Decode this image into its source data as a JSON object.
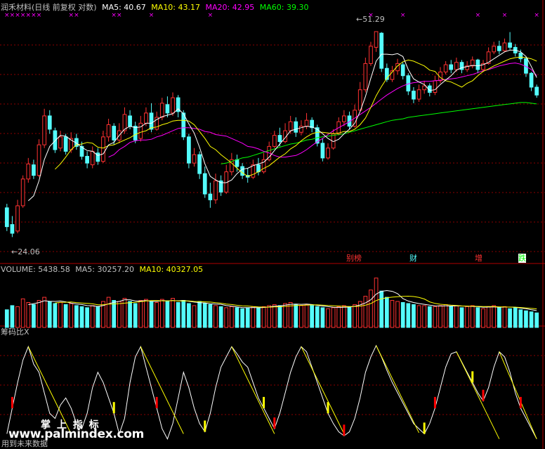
{
  "title": "润禾材料(日线 前复权 对数)",
  "colors": {
    "up": "#ff3232",
    "down": "#54fcfc",
    "ma5": "#ffffff",
    "ma10": "#ffff00",
    "ma20": "#ff00ff",
    "ma60": "#00ff00",
    "grid": "#8b0000",
    "text": "#c0c0c0"
  },
  "price_header": [
    {
      "text": "MA5: 40.67",
      "color": "#ffffff"
    },
    {
      "text": "MA10: 43.17",
      "color": "#ffff00"
    },
    {
      "text": "MA20: 42.95",
      "color": "#ff00ff"
    },
    {
      "text": "MA60: 39.30",
      "color": "#00ff00"
    }
  ],
  "volume_header": [
    {
      "text": "VOLUME: 5438.58",
      "color": "#c0c0c0"
    },
    {
      "text": "MA5: 30257.20",
      "color": "#c0c0c0"
    },
    {
      "text": "MA10: 40327.05",
      "color": "#ffff00"
    }
  ],
  "indicator_title": "筹码比X",
  "high_label": "51.29",
  "low_label": "24.06",
  "events": [
    {
      "text": "别榜",
      "color": "#ff3232"
    },
    {
      "text": "财",
      "color": "#54fcfc"
    },
    {
      "text": "增",
      "color": "#ff3232"
    },
    {
      "text": "跌",
      "color": "#00ff00"
    }
  ],
  "watermark": {
    "title": "掌 上 指 标",
    "subtitle": "用到未来数据",
    "site": "www.palmindex.com"
  },
  "chart_data": {
    "type": "candlestick",
    "title": "润禾材料(日线 前复权 对数)",
    "scale": "log",
    "ylim": [
      22,
      55
    ],
    "high_marker": 51.29,
    "low_marker": 24.06,
    "candles": [
      [
        26.8,
        25.0,
        27.2,
        24.6
      ],
      [
        25.2,
        24.4,
        26.0,
        24.06
      ],
      [
        24.6,
        27.0,
        27.6,
        24.4
      ],
      [
        27.0,
        29.8,
        30.2,
        26.8
      ],
      [
        29.8,
        31.5,
        32.2,
        29.4
      ],
      [
        31.4,
        30.2,
        32.0,
        29.8
      ],
      [
        30.2,
        33.8,
        34.5,
        30.0
      ],
      [
        33.8,
        37.6,
        38.6,
        33.4
      ],
      [
        37.6,
        35.8,
        38.4,
        35.2
      ],
      [
        35.6,
        33.2,
        36.0,
        32.8
      ],
      [
        33.4,
        34.8,
        35.6,
        33.0
      ],
      [
        34.8,
        33.0,
        35.2,
        32.6
      ],
      [
        33.2,
        34.6,
        35.4,
        32.8
      ],
      [
        34.6,
        33.6,
        35.2,
        33.2
      ],
      [
        33.6,
        32.4,
        34.2,
        32.0
      ],
      [
        32.4,
        31.6,
        33.0,
        31.0
      ],
      [
        31.4,
        33.0,
        33.6,
        31.0
      ],
      [
        32.8,
        31.8,
        33.4,
        31.4
      ],
      [
        31.8,
        34.8,
        35.6,
        31.6
      ],
      [
        34.8,
        36.4,
        37.2,
        34.2
      ],
      [
        36.2,
        34.4,
        36.6,
        33.8
      ],
      [
        34.4,
        35.6,
        36.6,
        34.0
      ],
      [
        35.6,
        37.8,
        38.8,
        35.2
      ],
      [
        37.6,
        36.2,
        38.4,
        35.8
      ],
      [
        36.2,
        34.4,
        36.8,
        34.0
      ],
      [
        34.6,
        36.6,
        37.6,
        34.2
      ],
      [
        36.6,
        38.0,
        38.8,
        36.2
      ],
      [
        38.0,
        35.8,
        39.4,
        35.4
      ],
      [
        35.8,
        37.4,
        38.2,
        35.6
      ],
      [
        37.4,
        39.4,
        40.2,
        37.0
      ],
      [
        39.2,
        38.0,
        40.4,
        37.4
      ],
      [
        38.0,
        40.2,
        41.0,
        37.6
      ],
      [
        40.2,
        38.2,
        40.6,
        37.4
      ],
      [
        38.0,
        34.8,
        38.4,
        34.4
      ],
      [
        34.8,
        31.6,
        35.2,
        31.0
      ],
      [
        31.6,
        32.6,
        33.4,
        31.2
      ],
      [
        32.6,
        30.4,
        33.0,
        29.8
      ],
      [
        30.4,
        28.2,
        31.2,
        27.8
      ],
      [
        28.2,
        27.6,
        29.4,
        26.8
      ],
      [
        27.6,
        29.6,
        30.4,
        27.2
      ],
      [
        29.6,
        28.4,
        30.2,
        28.0
      ],
      [
        28.4,
        30.6,
        31.4,
        28.2
      ],
      [
        30.6,
        32.0,
        32.8,
        30.2
      ],
      [
        32.0,
        31.2,
        32.6,
        30.6
      ],
      [
        31.2,
        30.2,
        31.6,
        29.8
      ],
      [
        30.2,
        30.0,
        31.0,
        29.4
      ],
      [
        30.0,
        31.4,
        32.0,
        29.8
      ],
      [
        31.4,
        30.6,
        32.2,
        30.2
      ],
      [
        30.6,
        32.0,
        32.8,
        30.4
      ],
      [
        32.0,
        33.6,
        34.2,
        31.8
      ],
      [
        33.6,
        35.0,
        35.6,
        33.4
      ],
      [
        35.0,
        34.2,
        36.0,
        33.6
      ],
      [
        34.2,
        35.6,
        36.6,
        34.0
      ],
      [
        35.6,
        36.8,
        37.6,
        35.2
      ],
      [
        36.8,
        35.4,
        37.4,
        34.8
      ],
      [
        35.4,
        36.2,
        37.0,
        35.0
      ],
      [
        36.2,
        37.0,
        38.0,
        35.8
      ],
      [
        37.0,
        36.0,
        37.4,
        35.4
      ],
      [
        36.0,
        34.0,
        36.4,
        33.6
      ],
      [
        34.0,
        32.2,
        34.6,
        31.8
      ],
      [
        32.2,
        33.4,
        34.0,
        32.0
      ],
      [
        33.4,
        35.2,
        35.8,
        33.2
      ],
      [
        35.2,
        36.8,
        37.4,
        35.0
      ],
      [
        36.8,
        37.6,
        38.4,
        36.2
      ],
      [
        37.6,
        36.2,
        38.2,
        35.8
      ],
      [
        36.2,
        38.4,
        39.2,
        36.0
      ],
      [
        38.4,
        41.4,
        42.6,
        38.2
      ],
      [
        41.4,
        45.6,
        46.6,
        41.0
      ],
      [
        45.6,
        48.6,
        49.4,
        45.2
      ],
      [
        48.4,
        51.29,
        51.29,
        47.6
      ],
      [
        51.0,
        44.8,
        51.2,
        44.2
      ],
      [
        44.8,
        43.0,
        45.6,
        42.6
      ],
      [
        43.0,
        44.4,
        45.2,
        42.6
      ],
      [
        44.4,
        45.6,
        46.4,
        43.8
      ],
      [
        45.4,
        43.6,
        45.8,
        43.0
      ],
      [
        43.6,
        41.2,
        44.0,
        40.6
      ],
      [
        41.2,
        40.0,
        41.8,
        39.4
      ],
      [
        40.0,
        41.4,
        42.2,
        39.6
      ],
      [
        41.4,
        42.0,
        42.8,
        40.8
      ],
      [
        42.0,
        41.0,
        42.4,
        40.4
      ],
      [
        41.0,
        42.8,
        43.6,
        40.6
      ],
      [
        42.8,
        44.2,
        45.0,
        42.4
      ],
      [
        44.2,
        45.4,
        46.0,
        43.8
      ],
      [
        45.4,
        44.6,
        46.2,
        44.0
      ],
      [
        44.6,
        45.8,
        46.6,
        44.2
      ],
      [
        45.8,
        44.6,
        46.2,
        44.0
      ],
      [
        44.6,
        45.2,
        46.0,
        44.2
      ],
      [
        45.2,
        46.2,
        46.8,
        44.8
      ],
      [
        46.2,
        44.6,
        46.4,
        44.0
      ],
      [
        44.6,
        45.6,
        46.2,
        44.2
      ],
      [
        45.6,
        47.6,
        48.4,
        45.4
      ],
      [
        47.6,
        48.6,
        49.4,
        47.2
      ],
      [
        48.6,
        47.8,
        49.6,
        47.2
      ],
      [
        47.8,
        49.2,
        50.0,
        47.6
      ],
      [
        49.2,
        48.4,
        51.2,
        48.0
      ],
      [
        48.4,
        47.4,
        49.0,
        46.8
      ],
      [
        47.4,
        46.4,
        48.0,
        45.8
      ],
      [
        46.4,
        44.0,
        46.8,
        43.4
      ],
      [
        44.0,
        41.8,
        44.2,
        41.2
      ],
      [
        41.8,
        40.6,
        42.2,
        40.2
      ]
    ],
    "ma5": [
      null,
      null,
      null,
      null,
      27.5,
      28.0,
      29.6,
      32.0,
      33.6,
      34.3,
      35.0,
      34.9,
      34.4,
      34.0,
      33.5,
      33.1,
      33.0,
      32.5,
      32.7,
      33.8,
      34.1,
      35.0,
      35.8,
      36.2,
      36.0,
      36.1,
      36.6,
      36.6,
      37.1,
      37.5,
      37.7,
      37.9,
      38.6,
      37.9,
      36.5,
      35.3,
      33.5,
      31.5,
      30.1,
      29.7,
      29.4,
      29.4,
      29.7,
      30.4,
      30.9,
      31.0,
      31.3,
      31.5,
      31.7,
      32.3,
      33.1,
      33.9,
      34.7,
      35.6,
      35.8,
      36.0,
      36.2,
      36.1,
      35.8,
      35.2,
      34.6,
      34.2,
      34.5,
      35.2,
      35.8,
      36.6,
      38.2,
      40.4,
      43.2,
      46.0,
      47.2,
      47.2,
      47.1,
      47.3,
      46.8,
      44.6,
      43.1,
      42.6,
      42.2,
      41.3,
      41.4,
      42.2,
      42.9,
      43.6,
      44.5,
      44.9,
      45.1,
      45.3,
      45.2,
      45.4,
      45.8,
      46.4,
      47.0,
      47.6,
      47.9,
      47.9,
      47.6,
      46.8,
      45.1,
      43.3
    ],
    "ma10": [
      null,
      null,
      null,
      null,
      null,
      null,
      null,
      null,
      null,
      30.9,
      31.5,
      32.3,
      33.2,
      33.8,
      33.9,
      34.1,
      34.0,
      33.5,
      33.4,
      33.7,
      33.8,
      34.1,
      34.4,
      34.7,
      35.1,
      35.4,
      35.6,
      36.0,
      36.1,
      36.4,
      36.6,
      36.9,
      37.0,
      37.0,
      36.9,
      36.4,
      35.5,
      34.6,
      33.6,
      33.2,
      32.6,
      32.1,
      31.6,
      31.0,
      30.5,
      30.1,
      30.3,
      30.6,
      31.0,
      31.3,
      31.8,
      32.3,
      32.7,
      33.3,
      33.7,
      34.3,
      34.8,
      35.2,
      35.4,
      35.4,
      35.3,
      35.2,
      35.3,
      35.5,
      35.5,
      35.8,
      36.4,
      37.3,
      38.8,
      40.5,
      41.9,
      43.2,
      44.2,
      45.2,
      45.9,
      46.2,
      46.0,
      45.6,
      45.2,
      44.5,
      44.3,
      43.3,
      42.8,
      42.6,
      42.2,
      41.8,
      42.4,
      42.8,
      43.6,
      44.3,
      44.7,
      45.2,
      45.6,
      46.0,
      46.4,
      46.6,
      46.7,
      46.6,
      46.4,
      46.0
    ],
    "ma20": [
      null,
      null,
      null,
      null,
      null,
      null,
      null,
      null,
      null,
      null,
      null,
      null,
      null,
      null,
      null,
      null,
      null,
      null,
      null,
      32.3,
      32.6,
      33.2,
      33.6,
      34.1,
      34.3,
      34.4,
      34.4,
      34.5,
      34.8,
      35.0,
      35.3,
      35.6,
      35.9,
      36.0,
      36.0,
      35.9,
      35.8,
      35.5,
      35.4,
      35.1,
      35.0,
      34.9,
      34.6,
      34.3,
      34.0,
      33.6,
      33.5,
      33.3,
      33.0,
      32.8,
      32.5,
      32.3,
      32.3,
      32.4,
      32.5,
      32.8,
      33.2,
      33.7,
      34.2,
      34.6,
      35.1,
      35.6,
      36.0,
      36.4,
      36.8,
      37.3,
      37.8,
      38.3,
      38.8,
      39.4,
      40.0,
      40.6,
      41.1,
      41.6,
      42.0,
      42.3,
      42.5,
      42.6,
      42.7,
      42.7,
      42.8,
      42.9,
      43.0,
      43.1,
      43.2,
      43.4,
      43.6,
      43.8,
      44.1,
      44.4,
      44.6,
      44.9,
      45.2,
      45.4,
      45.6,
      45.7,
      45.5,
      45.1,
      44.6,
      43.6
    ],
    "ma60": [
      null,
      null,
      null,
      null,
      null,
      null,
      null,
      null,
      null,
      null,
      null,
      null,
      null,
      null,
      null,
      null,
      null,
      null,
      null,
      null,
      null,
      null,
      null,
      null,
      null,
      null,
      null,
      null,
      null,
      null,
      null,
      null,
      null,
      null,
      null,
      null,
      null,
      null,
      null,
      null,
      31.5,
      31.6,
      31.8,
      32.0,
      32.2,
      32.3,
      32.5,
      32.7,
      32.9,
      33.1,
      33.3,
      33.5,
      33.7,
      33.9,
      34.0,
      34.2,
      34.4,
      34.5,
      34.7,
      34.8,
      34.9,
      35.0,
      35.1,
      35.2,
      35.4,
      35.6,
      35.8,
      36.0,
      36.2,
      36.4,
      36.6,
      36.8,
      37.0,
      37.1,
      37.2,
      37.4,
      37.5,
      37.6,
      37.7,
      37.8,
      37.9,
      38.0,
      38.1,
      38.2,
      38.3,
      38.4,
      38.5,
      38.6,
      38.7,
      38.8,
      38.9,
      39.0,
      39.1,
      39.2,
      39.3,
      39.4,
      39.5,
      39.5,
      39.4,
      39.3
    ],
    "volume": {
      "ylim": [
        0,
        100
      ],
      "values": [
        34,
        42,
        40,
        55,
        48,
        44,
        52,
        58,
        50,
        46,
        48,
        44,
        46,
        42,
        40,
        38,
        42,
        40,
        50,
        58,
        52,
        50,
        56,
        50,
        46,
        52,
        54,
        50,
        48,
        54,
        50,
        56,
        48,
        52,
        46,
        42,
        50,
        46,
        44,
        42,
        40,
        38,
        40,
        38,
        36,
        38,
        40,
        38,
        40,
        42,
        44,
        42,
        46,
        48,
        44,
        42,
        44,
        42,
        40,
        38,
        36,
        38,
        40,
        42,
        40,
        44,
        50,
        60,
        72,
        95,
        70,
        58,
        52,
        50,
        48,
        46,
        44,
        42,
        42,
        40,
        40,
        42,
        44,
        40,
        42,
        38,
        40,
        42,
        38,
        36,
        40,
        42,
        38,
        40,
        36,
        38,
        34,
        32,
        30,
        28
      ],
      "ma5_label": "MA5",
      "ma10_label": "MA10"
    },
    "indicator": {
      "name": "筹码比X",
      "line1": [
        0.1,
        0.35,
        0.6,
        0.82,
        0.95,
        0.78,
        0.7,
        0.5,
        0.3,
        0.25,
        0.38,
        0.45,
        0.35,
        0.2,
        0.15,
        0.3,
        0.55,
        0.7,
        0.6,
        0.45,
        0.3,
        0.1,
        0.25,
        0.6,
        0.85,
        0.95,
        0.75,
        0.55,
        0.35,
        0.15,
        0.05,
        0.2,
        0.45,
        0.7,
        0.55,
        0.35,
        0.2,
        0.12,
        0.3,
        0.55,
        0.75,
        0.85,
        0.95,
        0.88,
        0.8,
        0.75,
        0.6,
        0.45,
        0.35,
        0.25,
        0.15,
        0.3,
        0.5,
        0.7,
        0.85,
        0.95,
        0.9,
        0.75,
        0.6,
        0.45,
        0.3,
        0.2,
        0.12,
        0.08,
        0.12,
        0.25,
        0.45,
        0.7,
        0.85,
        0.96,
        0.85,
        0.72,
        0.6,
        0.5,
        0.4,
        0.3,
        0.2,
        0.15,
        0.1,
        0.2,
        0.35,
        0.55,
        0.75,
        0.88,
        0.9,
        0.8,
        0.7,
        0.6,
        0.5,
        0.42,
        0.55,
        0.75,
        0.9,
        0.85,
        0.7,
        0.5,
        0.35,
        0.25,
        0.15,
        0.05
      ],
      "bars": [
        {
          "i": 1,
          "c": "#ff0000"
        },
        {
          "i": 20,
          "c": "#ffff00"
        },
        {
          "i": 28,
          "c": "#ff0000"
        },
        {
          "i": 37,
          "c": "#ffff00"
        },
        {
          "i": 48,
          "c": "#ffff00"
        },
        {
          "i": 50,
          "c": "#ff0000"
        },
        {
          "i": 60,
          "c": "#ffff00"
        },
        {
          "i": 63,
          "c": "#ff0000"
        },
        {
          "i": 78,
          "c": "#ffff00"
        },
        {
          "i": 80,
          "c": "#ff0000"
        },
        {
          "i": 87,
          "c": "#ffff00"
        },
        {
          "i": 89,
          "c": "#ff0000"
        },
        {
          "i": 96,
          "c": "#ff0000"
        }
      ]
    }
  }
}
